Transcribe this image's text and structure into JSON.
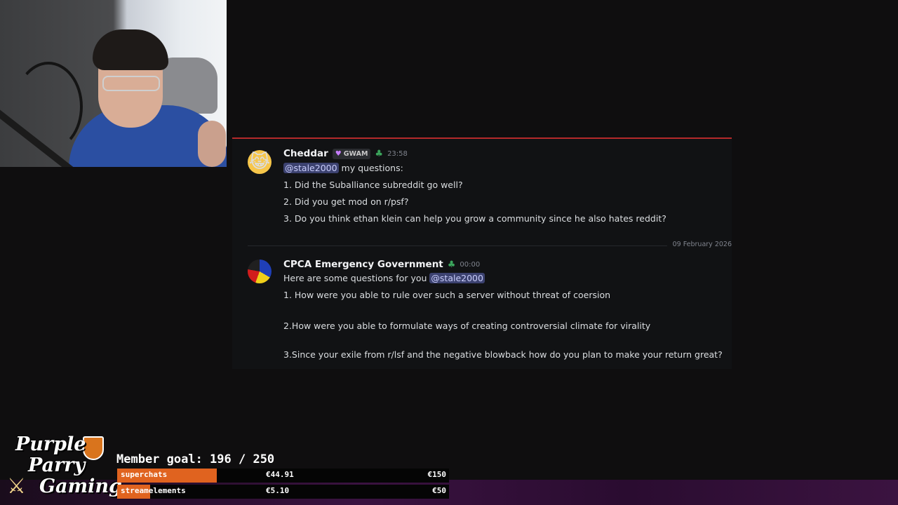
{
  "discord": {
    "messages": [
      {
        "username": "Cheddar",
        "tag": "GWAM",
        "time": "23:58",
        "mention": "@stale2000",
        "after_mention": " my questions:",
        "lines": [
          "1. Did the Suballiance subreddit go well?",
          "2. Did you get mod on r/psf?",
          "3. Do you think ethan klein can help you grow a community since he also hates reddit?"
        ]
      },
      {
        "username": "CPCA Emergency Government",
        "time": "00:00",
        "intro": "Here are some questions for you ",
        "mention": "@stale2000",
        "lines": [
          "1. How were you able to rule over such a server without threat of coersion",
          "2.How were you able to formulate ways of creating controversial climate for virality",
          "3.Since your exile from r/lsf and the negative blowback how do you plan to make your return great?"
        ]
      }
    ],
    "date_separator": "09 February 2026",
    "accent_color": "#b52a2a",
    "mention_color": "#3c4270"
  },
  "overlay": {
    "logo": {
      "line1": "Purple",
      "line2": "Parry",
      "line3": "Gaming"
    },
    "goal_title": "Member goal: 196 / 250",
    "bars": [
      {
        "label": "superchats",
        "value": "€44.91",
        "max": "€150",
        "progress": 0.3,
        "color": "#e0631f"
      },
      {
        "label": "streamelements",
        "value": "€5.10",
        "max": "€50",
        "progress": 0.1,
        "color": "#e0631f"
      }
    ]
  }
}
